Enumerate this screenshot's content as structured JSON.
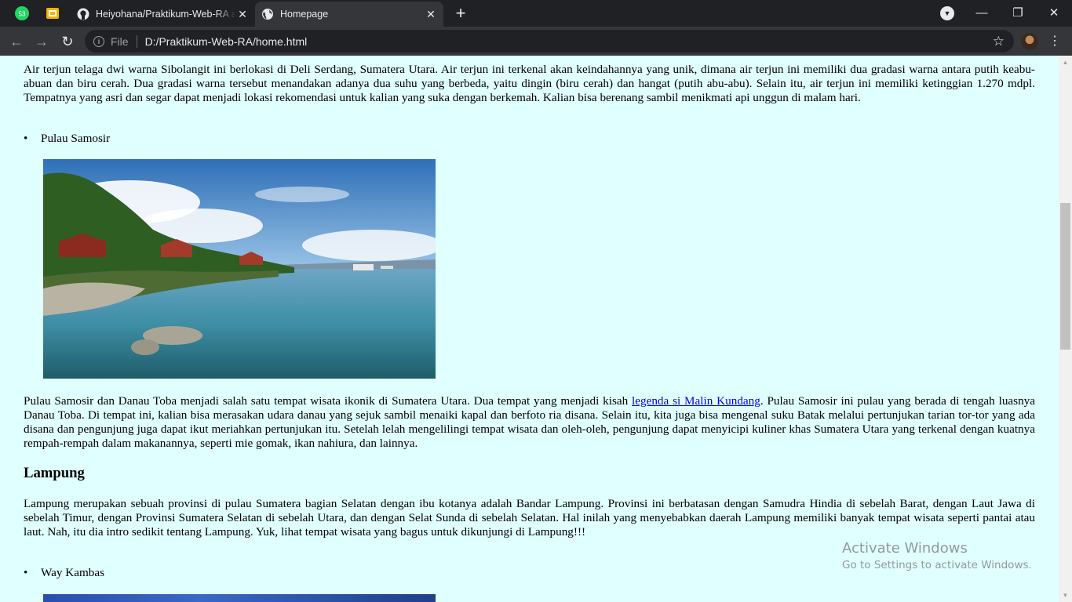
{
  "tabs": {
    "pinned": [
      {
        "icon": "whatsapp-icon",
        "badge": "53",
        "color": "#25d366"
      },
      {
        "icon": "google-slides-icon",
        "color": "#f4b400"
      }
    ],
    "items": [
      {
        "title": "Heiyohana/Praktikum-Web-RA at main",
        "icon": "github-icon",
        "active": false
      },
      {
        "title": "Homepage",
        "icon": "globe-icon",
        "active": true
      }
    ],
    "new_tab_symbol": "+"
  },
  "toolbar": {
    "back_symbol": "←",
    "forward_symbol": "→",
    "reload_symbol": "↻",
    "scheme_label": "File",
    "url": "D:/Praktikum-Web-RA/home.html",
    "bookmark_symbol": "☆",
    "menu_symbol": "⋮"
  },
  "window": {
    "minimize": "—",
    "maximize": "❐",
    "close": "✕"
  },
  "page": {
    "paragraph_sibolangit": "Air terjun telaga dwi warna Sibolangit ini berlokasi di Deli Serdang, Sumatera Utara. Air terjun ini terkenal akan keindahannya yang unik, dimana air terjun ini memiliki dua gradasi warna antara putih keabu-abuan dan biru cerah. Dua gradasi warna tersebut menandakan adanya dua suhu yang berbeda, yaitu dingin (biru cerah) dan hangat (putih abu-abu). Selain itu, air terjun ini memiliki ketinggian 1.270 mdpl. Tempatnya yang asri dan segar dapat menjadi lokasi rekomendasi untuk kalian yang suka dengan berkemah. Kalian bisa berenang sambil menikmati api unggun di malam hari.",
    "item_samosir": "Pulau Samosir",
    "samosir_text_before": "Pulau Samosir dan Danau Toba menjadi salah satu tempat wisata ikonik di Sumatera Utara. Dua tempat yang menjadi kisah ",
    "samosir_link": "legenda si Malin Kundang",
    "samosir_text_after": ". Pulau Samosir ini pulau yang berada di tengah luasnya Danau Toba. Di tempat ini, kalian bisa merasakan udara danau yang sejuk sambil menaiki kapal dan berfoto ria disana. Selain itu, kita juga bisa mengenal suku Batak melalui pertunjukan tarian tor-tor yang ada disana dan pengunjung juga dapat ikut meriahkan pertunjukan itu. Setelah lelah mengelilingi tempat wisata dan oleh-oleh, pengunjung dapat menyicipi kuliner khas Sumatera Utara yang terkenal dengan kuatnya rempah-rempah dalam makanannya, seperti mie gomak, ikan nahiura, dan lainnya.",
    "heading_lampung": "Lampung",
    "paragraph_lampung": "Lampung merupakan sebuah provinsi di pulau Sumatera bagian Selatan dengan ibu kotanya adalah Bandar Lampung. Provinsi ini berbatasan dengan Samudra Hindia di sebelah Barat, dengan Laut Jawa di sebelah Timur, dengan Provinsi Sumatera Selatan di sebelah Utara, dan dengan Selat Sunda di sebelah Selatan. Hal inilah yang menyebabkan daerah Lampung memiliki banyak tempat wisata seperti pantai atau laut. Nah, itu dia intro sedikit tentang Lampung. Yuk, lihat tempat wisata yang bagus untuk dikunjungi di Lampung!!!",
    "item_waykambas": "Way Kambas"
  },
  "watermark": {
    "title": "Activate Windows",
    "subtitle": "Go to Settings to activate Windows."
  },
  "colors": {
    "page_bg": "#e0ffff",
    "link": "#0000ee",
    "tabstrip_bg": "#202124",
    "toolbar_bg": "#35363a"
  }
}
